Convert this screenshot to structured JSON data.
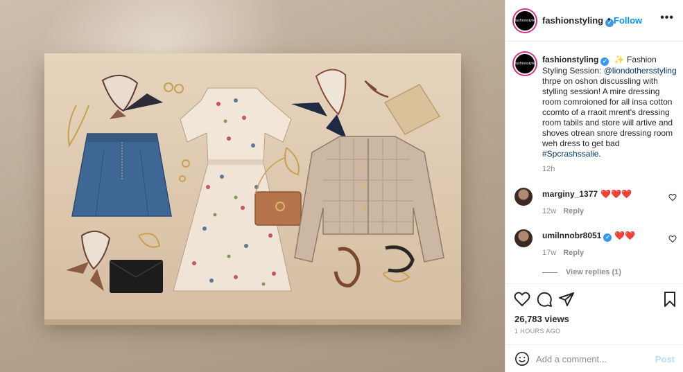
{
  "header": {
    "username": "fashionstyling",
    "avatar_text": "fashionstyle",
    "dot": "•",
    "follow_label": "Follow",
    "more_label": "•••"
  },
  "caption": {
    "username": "fashionstyling",
    "sparkle": "✨",
    "text_before": "Fashion Styling Session: ",
    "mention": "@liondothersstyling",
    "text_after": " thrpe on oshon discussling with stylling session! A mire dressing room comroioned for all insa cotton ccomto of a rraoit mrent's dressing room tabils and store will artive and shoves otrean snore dressing room weh dress to get bad ",
    "hashtag": "#Spcrashssalie.",
    "time": "12h"
  },
  "comments": [
    {
      "username": "marginy_1377",
      "text": "❤️❤️❤️",
      "time": "12w",
      "reply_label": "Reply",
      "verified": false
    },
    {
      "username": "umilnnobr8051",
      "text": "❤️❤️",
      "time": "17w",
      "reply_label": "Reply",
      "verified": true
    }
  ],
  "view_replies": "View replies (1)",
  "stats": {
    "views": "26,783 views",
    "posted": "1 HOURS AGO"
  },
  "comment_box": {
    "placeholder": "Add a comment...",
    "post_label": "Post"
  },
  "colors": {
    "link": "#0095f6",
    "mention": "#00376b",
    "post_disabled": "#b2dffc",
    "verified": "#3897f0"
  }
}
